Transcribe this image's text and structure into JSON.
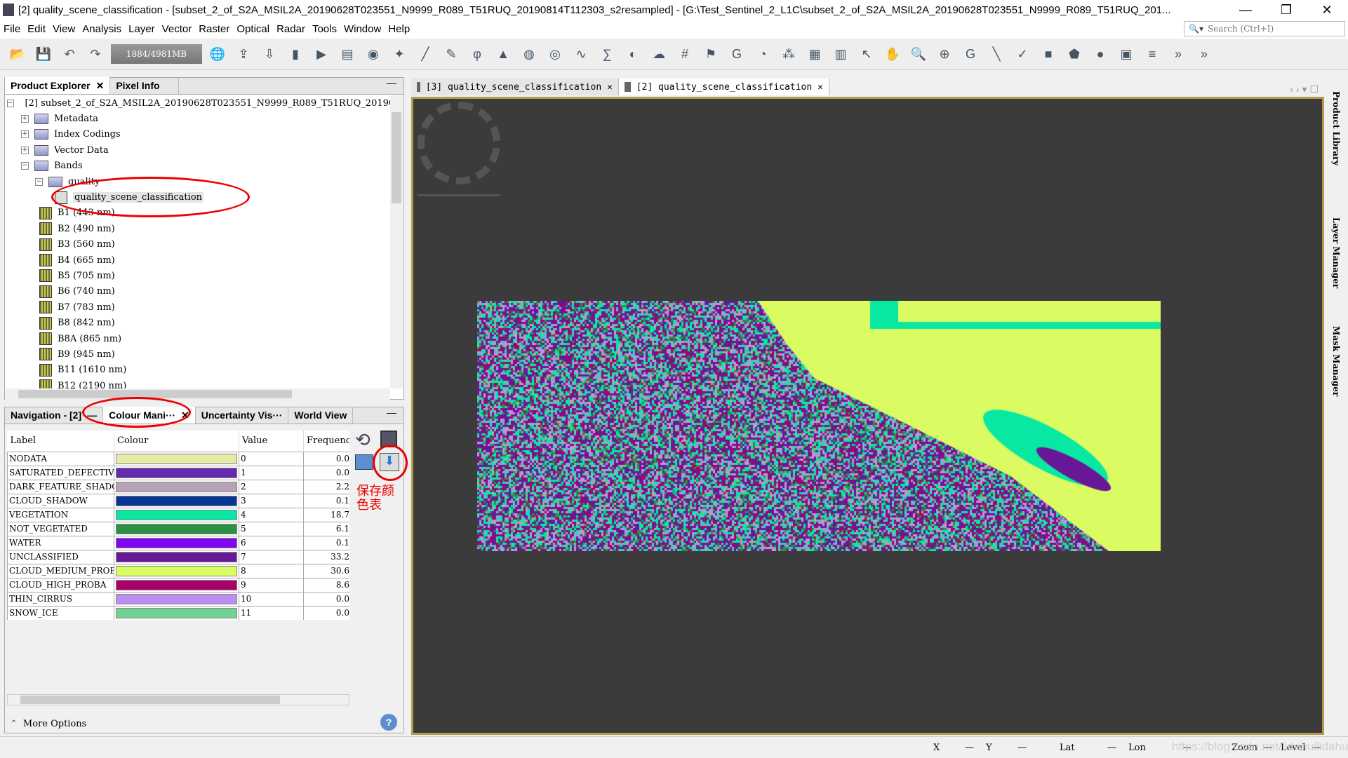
{
  "window": {
    "title": "[2] quality_scene_classification - [subset_2_of_S2A_MSIL2A_20190628T023551_N9999_R089_T51RUQ_20190814T112303_s2resampled] - [G:\\Test_Sentinel_2_L1C\\subset_2_of_S2A_MSIL2A_20190628T023551_N9999_R089_T51RUQ_201...",
    "minimize": "—",
    "restore": "❐",
    "close": "✕"
  },
  "menu": [
    "File",
    "Edit",
    "View",
    "Analysis",
    "Layer",
    "Vector",
    "Raster",
    "Optical",
    "Radar",
    "Tools",
    "Window",
    "Help"
  ],
  "search": {
    "placeholder": "Search (Ctrl+I)"
  },
  "toolbar": {
    "memory": "1884/4981MB"
  },
  "explorer": {
    "tabs": [
      "Product Explorer",
      "Pixel Info"
    ],
    "product": "[2]  subset_2_of_S2A_MSIL2A_20190628T023551_N9999_R089_T51RUQ_20190",
    "folders": [
      "Metadata",
      "Index Codings",
      "Vector Data",
      "Bands"
    ],
    "group": "quality",
    "selected": "quality_scene_classification",
    "bands": [
      "B1  (443 nm)",
      "B2  (490 nm)",
      "B3  (560 nm)",
      "B4  (665 nm)",
      "B5  (705 nm)",
      "B6  (740 nm)",
      "B7  (783 nm)",
      "B8  (842 nm)",
      "B8A  (865 nm)",
      "B9  (945 nm)",
      "B11  (1610 nm)",
      "B12  (2190 nm)"
    ]
  },
  "lower": {
    "tabs": [
      "Navigation - [2]",
      "Colour Mani···",
      "Uncertainty Vis···",
      "World View"
    ],
    "columns": [
      "Label",
      "Colour",
      "Value",
      "Frequency"
    ],
    "rows": [
      {
        "label": "NODATA",
        "color": "#e6eba8",
        "value": "0",
        "freq": "0.0"
      },
      {
        "label": "SATURATED_DEFECTIVE",
        "color": "#632ab0",
        "value": "1",
        "freq": "0.0"
      },
      {
        "label": "DARK_FEATURE_SHADOW",
        "color": "#b6a3b8",
        "value": "2",
        "freq": "2.2"
      },
      {
        "label": "CLOUD_SHADOW",
        "color": "#063593",
        "value": "3",
        "freq": "0.1"
      },
      {
        "label": "VEGETATION",
        "color": "#09e8a3",
        "value": "4",
        "freq": "18.7"
      },
      {
        "label": "NOT_VEGETATED",
        "color": "#299141",
        "value": "5",
        "freq": "6.1"
      },
      {
        "label": "WATER",
        "color": "#7f06f1",
        "value": "6",
        "freq": "0.1"
      },
      {
        "label": "UNCLASSIFIED",
        "color": "#681896",
        "value": "7",
        "freq": "33.2"
      },
      {
        "label": "CLOUD_MEDIUM_PROBA",
        "color": "#dafb62",
        "value": "8",
        "freq": "30.6"
      },
      {
        "label": "CLOUD_HIGH_PROBA",
        "color": "#a8006a",
        "value": "9",
        "freq": "8.6"
      },
      {
        "label": "THIN_CIRRUS",
        "color": "#ba8ff1",
        "value": "10",
        "freq": "0.0"
      },
      {
        "label": "SNOW_ICE",
        "color": "#72d195",
        "value": "11",
        "freq": "0.0"
      }
    ],
    "annotation": "保存颜色表",
    "more_options": "More Options"
  },
  "view": {
    "tabs": [
      "[3]  quality_scene_classification",
      "[2]  quality_scene_classification"
    ]
  },
  "right_tools": [
    "Product Library",
    "Layer Manager",
    "Mask Manager"
  ],
  "status": {
    "x": "X",
    "y": "Y",
    "lat": "Lat",
    "lon": "Lon",
    "zoom": "Zoom",
    "level": "Level",
    "dash": "—",
    "watermark": "https://blog.csdn.net/lidahuilidahui"
  }
}
